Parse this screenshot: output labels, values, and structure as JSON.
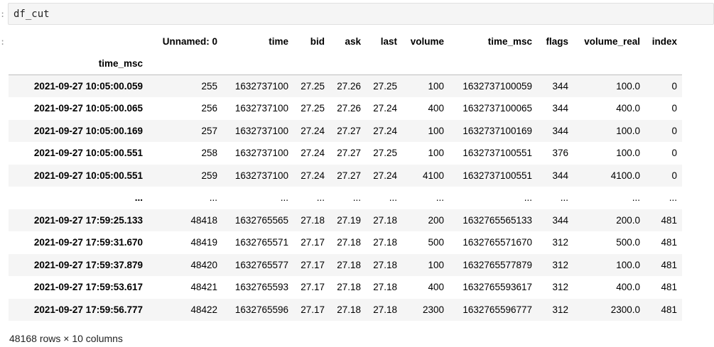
{
  "input": {
    "prompt": ":",
    "code": "df_cut"
  },
  "output": {
    "prompt": ":",
    "index_name": "time_msc",
    "columns": [
      "Unnamed: 0",
      "time",
      "bid",
      "ask",
      "last",
      "volume",
      "time_msc",
      "flags",
      "volume_real",
      "index"
    ],
    "rows": [
      {
        "index": "2021-09-27 10:05:00.059",
        "cells": [
          "255",
          "1632737100",
          "27.25",
          "27.26",
          "27.25",
          "100",
          "1632737100059",
          "344",
          "100.0",
          "0"
        ]
      },
      {
        "index": "2021-09-27 10:05:00.065",
        "cells": [
          "256",
          "1632737100",
          "27.25",
          "27.26",
          "27.24",
          "400",
          "1632737100065",
          "344",
          "400.0",
          "0"
        ]
      },
      {
        "index": "2021-09-27 10:05:00.169",
        "cells": [
          "257",
          "1632737100",
          "27.24",
          "27.27",
          "27.24",
          "100",
          "1632737100169",
          "344",
          "100.0",
          "0"
        ]
      },
      {
        "index": "2021-09-27 10:05:00.551",
        "cells": [
          "258",
          "1632737100",
          "27.24",
          "27.27",
          "27.25",
          "100",
          "1632737100551",
          "376",
          "100.0",
          "0"
        ]
      },
      {
        "index": "2021-09-27 10:05:00.551",
        "cells": [
          "259",
          "1632737100",
          "27.24",
          "27.27",
          "27.24",
          "4100",
          "1632737100551",
          "344",
          "4100.0",
          "0"
        ]
      },
      {
        "index": "...",
        "cells": [
          "...",
          "...",
          "...",
          "...",
          "...",
          "...",
          "...",
          "...",
          "...",
          "..."
        ]
      },
      {
        "index": "2021-09-27 17:59:25.133",
        "cells": [
          "48418",
          "1632765565",
          "27.18",
          "27.19",
          "27.18",
          "200",
          "1632765565133",
          "344",
          "200.0",
          "481"
        ]
      },
      {
        "index": "2021-09-27 17:59:31.670",
        "cells": [
          "48419",
          "1632765571",
          "27.17",
          "27.18",
          "27.18",
          "500",
          "1632765571670",
          "312",
          "500.0",
          "481"
        ]
      },
      {
        "index": "2021-09-27 17:59:37.879",
        "cells": [
          "48420",
          "1632765577",
          "27.17",
          "27.18",
          "27.18",
          "100",
          "1632765577879",
          "312",
          "100.0",
          "481"
        ]
      },
      {
        "index": "2021-09-27 17:59:53.617",
        "cells": [
          "48421",
          "1632765593",
          "27.17",
          "27.18",
          "27.18",
          "400",
          "1632765593617",
          "312",
          "400.0",
          "481"
        ]
      },
      {
        "index": "2021-09-27 17:59:56.777",
        "cells": [
          "48422",
          "1632765596",
          "27.17",
          "27.18",
          "27.18",
          "2300",
          "1632765596777",
          "312",
          "2300.0",
          "481"
        ]
      }
    ],
    "shape_text": "48168 rows × 10 columns"
  }
}
